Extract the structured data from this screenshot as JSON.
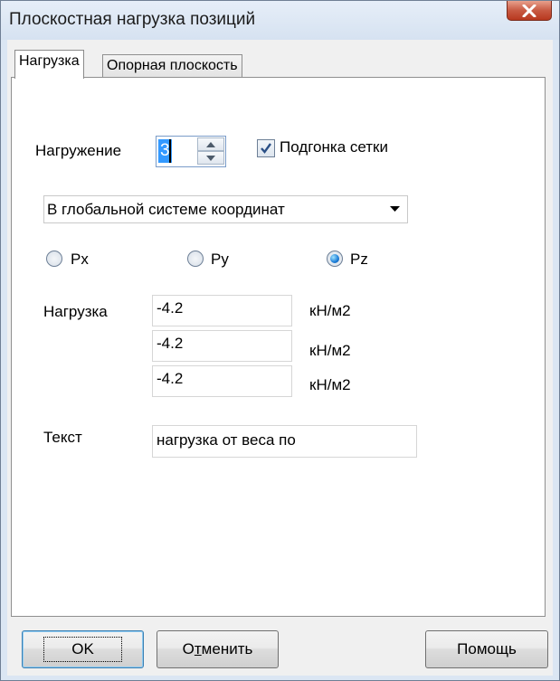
{
  "window": {
    "title": "Плоскостная нагрузка позиций"
  },
  "tabs": [
    {
      "label": "Нагрузка",
      "active": true
    },
    {
      "label": "Опорная плоскость",
      "active": false
    }
  ],
  "load_case": {
    "label": "Нагружение",
    "value": "3"
  },
  "mesh_fit": {
    "label": "Подгонка сетки",
    "checked": true
  },
  "coord_system": {
    "selected": "В глобальной системе координат"
  },
  "direction": {
    "options": [
      "Px",
      "Py",
      "Pz"
    ],
    "selected": "Pz"
  },
  "load": {
    "label": "Нагрузка",
    "values": [
      "-4.2",
      "-4.2",
      "-4.2"
    ],
    "units": [
      "кН/м2",
      "кН/м2",
      "кН/м2"
    ]
  },
  "text_field": {
    "label": "Текст",
    "value": "нагрузка от веса по"
  },
  "buttons": {
    "ok": "OK",
    "cancel_pre": "О",
    "cancel_underlined": "т",
    "cancel_post": "менить",
    "help": "Помощь"
  },
  "colors": {
    "selection": "#3399ff",
    "window_frame": "#dbe6f3",
    "close_button": "#c85a43"
  }
}
